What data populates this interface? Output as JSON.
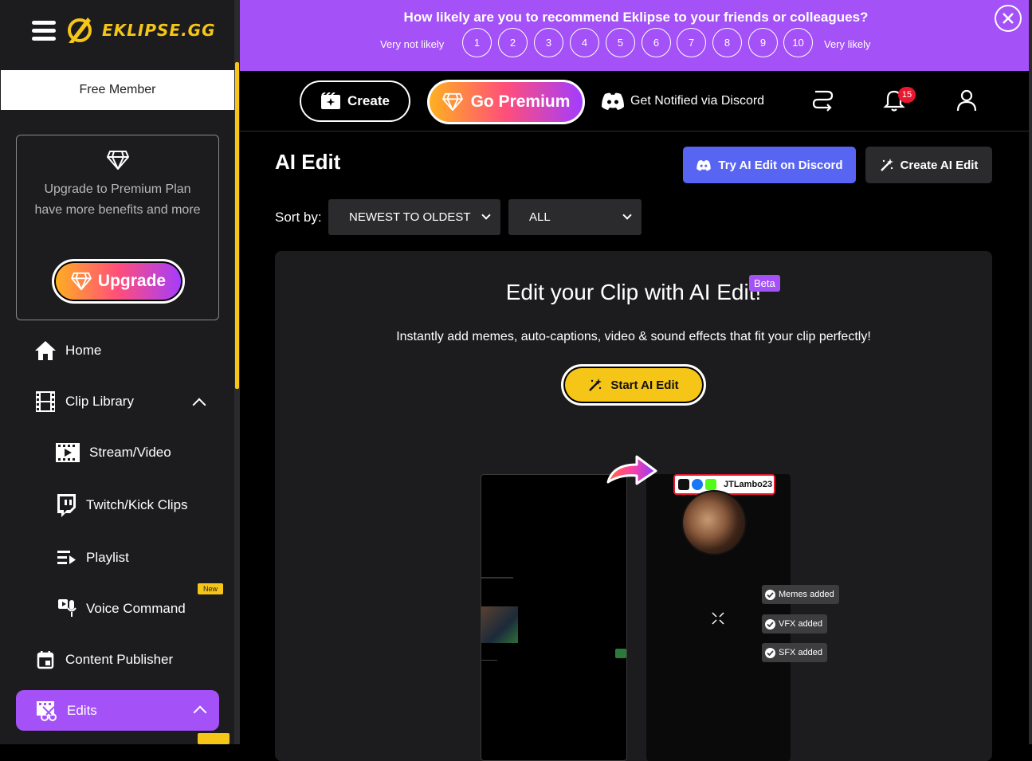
{
  "brand": {
    "name": "EKLIPSE.GG",
    "accent": "#f5c518",
    "purple": "#a451f7"
  },
  "sidebar": {
    "member_label": "Free Member",
    "upgrade_text": "Upgrade to Premium Plan have more benefits and more",
    "upgrade_button": "Upgrade",
    "items": [
      {
        "label": "Home",
        "icon": "home-icon"
      },
      {
        "label": "Clip Library",
        "icon": "film-icon"
      },
      {
        "label": "Stream/Video",
        "icon": "video-icon"
      },
      {
        "label": "Twitch/Kick Clips",
        "icon": "twitch-icon"
      },
      {
        "label": "Playlist",
        "icon": "playlist-icon"
      },
      {
        "label": "Voice Command",
        "icon": "voice-icon",
        "badge": "New"
      },
      {
        "label": "Content Publisher",
        "icon": "calendar-icon"
      },
      {
        "label": "Edits",
        "icon": "edits-icon",
        "active": true
      }
    ]
  },
  "survey": {
    "question": "How likely are you to recommend Eklipse to your friends or colleagues?",
    "low_label": "Very not likely",
    "high_label": "Very likely",
    "ratings": [
      "1",
      "2",
      "3",
      "4",
      "5",
      "6",
      "7",
      "8",
      "9",
      "10"
    ]
  },
  "topbar": {
    "create_label": "Create",
    "premium_label": "Go Premium",
    "discord_label": "Get Notified via Discord",
    "notification_count": "15"
  },
  "main": {
    "title": "AI Edit",
    "try_discord_label": "Try AI Edit on Discord",
    "create_ai_label": "Create AI Edit",
    "sort_label": "Sort by:",
    "sort_value": "NEWEST TO OLDEST",
    "filter_value": "ALL"
  },
  "promo": {
    "title": "Edit your Clip with AI Edit!",
    "beta": "Beta",
    "subtitle": "Instantly add memes, auto-captions, video & sound effects that fit your clip perfectly!",
    "button": "Start AI Edit",
    "streamer": "JTLambo23",
    "features": [
      "Memes added",
      "VFX added",
      "SFX added"
    ]
  }
}
